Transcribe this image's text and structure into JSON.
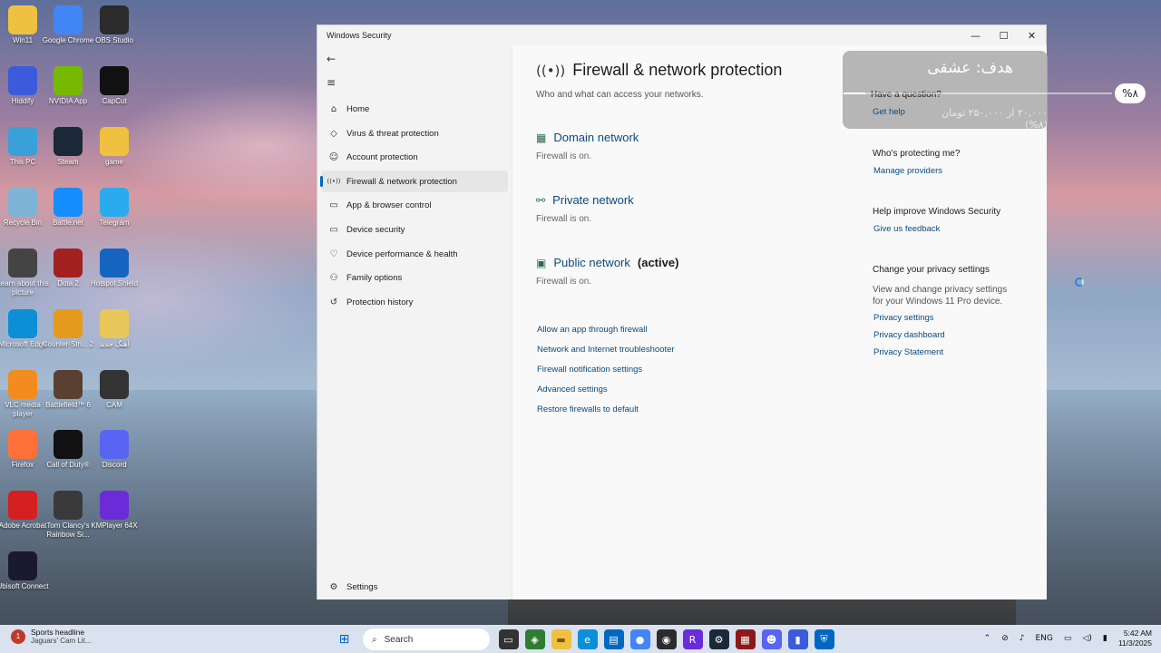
{
  "desktop": {
    "icons": [
      {
        "label": "Win11",
        "icon": "folder-icon",
        "color": "#f0c040"
      },
      {
        "label": "Google Chrome",
        "icon": "chrome-icon",
        "color": "#4285f4"
      },
      {
        "label": "OBS Studio",
        "icon": "obs-icon",
        "color": "#2b2b2b"
      },
      {
        "label": "Hiddify",
        "icon": "hiddify-icon",
        "color": "#3b5bdb"
      },
      {
        "label": "NVIDIA App",
        "icon": "nvidia-icon",
        "color": "#76b900"
      },
      {
        "label": "CapCut",
        "icon": "capcut-icon",
        "color": "#111111"
      },
      {
        "label": "This PC",
        "icon": "computer-icon",
        "color": "#3aa0d8"
      },
      {
        "label": "Steam",
        "icon": "steam-icon",
        "color": "#1b2838"
      },
      {
        "label": "game",
        "icon": "folder-icon",
        "color": "#f0c040"
      },
      {
        "label": "Recycle Bin",
        "icon": "recycle-bin-icon",
        "color": "#7fb3d5"
      },
      {
        "label": "Battle.net",
        "icon": "battlenet-icon",
        "color": "#148eff"
      },
      {
        "label": "Telegram",
        "icon": "telegram-icon",
        "color": "#2aabee"
      },
      {
        "label": "Learn about this picture",
        "icon": "camera-icon",
        "color": "#444444"
      },
      {
        "label": "Dota 2",
        "icon": "dota-icon",
        "color": "#a32020"
      },
      {
        "label": "Hotspot Shield",
        "icon": "hotspot-shield-icon",
        "color": "#1565c0"
      },
      {
        "label": "Microsoft Edge",
        "icon": "edge-icon",
        "color": "#0c8fd6"
      },
      {
        "label": "Counter-Stri... 2",
        "icon": "cs2-icon",
        "color": "#e69a1c"
      },
      {
        "label": "آهنگ جدید",
        "icon": "folder-icon",
        "color": "#e8c85a"
      },
      {
        "label": "VLC media player",
        "icon": "vlc-icon",
        "color": "#f28c1e"
      },
      {
        "label": "Battlefield™ 6",
        "icon": "battlefield-icon",
        "color": "#5a4030"
      },
      {
        "label": "CAM",
        "icon": "cam-icon",
        "color": "#333333"
      },
      {
        "label": "Firefox",
        "icon": "firefox-icon",
        "color": "#ff7139"
      },
      {
        "label": "Call of Duty®",
        "icon": "cod-icon",
        "color": "#111111"
      },
      {
        "label": "Discord",
        "icon": "discord-icon",
        "color": "#5865f2"
      },
      {
        "label": "Adobe Acrobat",
        "icon": "acrobat-icon",
        "color": "#d42020"
      },
      {
        "label": "Tom Clancy's Rainbow Si...",
        "icon": "rainbow-six-icon",
        "color": "#3a3a3a"
      },
      {
        "label": "KMPlayer 64X",
        "icon": "kmplayer-icon",
        "color": "#6a2bd8"
      },
      {
        "label": "Ubisoft Connect",
        "icon": "ubisoft-icon",
        "color": "#1a1a2e"
      }
    ]
  },
  "window": {
    "title": "Windows Security",
    "minimize": "—",
    "maximize": "☐",
    "close": "✕"
  },
  "nav": {
    "back": "←",
    "menu": "≡",
    "items": [
      {
        "label": "Home",
        "icon": "⌂"
      },
      {
        "label": "Virus & threat protection",
        "icon": "◇"
      },
      {
        "label": "Account protection",
        "icon": "☺"
      },
      {
        "label": "Firewall & network protection",
        "icon": "((•))"
      },
      {
        "label": "App & browser control",
        "icon": "▭"
      },
      {
        "label": "Device security",
        "icon": "▭"
      },
      {
        "label": "Device performance & health",
        "icon": "♡"
      },
      {
        "label": "Family options",
        "icon": "⚇"
      },
      {
        "label": "Protection history",
        "icon": "↺"
      }
    ],
    "settings": "Settings",
    "settings_icon": "⚙"
  },
  "main": {
    "title": "Firewall & network protection",
    "subtitle": "Who and what can access your networks.",
    "networks": [
      {
        "name": "Domain network",
        "status": "Firewall is on.",
        "active": ""
      },
      {
        "name": "Private network",
        "status": "Firewall is on.",
        "active": ""
      },
      {
        "name": "Public network",
        "status": "Firewall is on.",
        "active": "(active)"
      }
    ],
    "links": [
      "Allow an app through firewall",
      "Network and Internet troubleshooter",
      "Firewall notification settings",
      "Advanced settings",
      "Restore firewalls to default"
    ]
  },
  "side": {
    "question": "Have a question?",
    "get_help": "Get help",
    "protecting": "Who's protecting me?",
    "manage_providers": "Manage providers",
    "improve": "Help improve Windows Security",
    "feedback": "Give us feedback",
    "privacy_heading": "Change your privacy settings",
    "privacy_text": "View and change privacy settings for your Windows 11 Pro device.",
    "privacy_settings": "Privacy settings",
    "privacy_dashboard": "Privacy dashboard",
    "privacy_statement": "Privacy Statement"
  },
  "overlay": {
    "goal": "هدف: عشقی",
    "amount": "۲۰,۰۰۰ از ۲۵۰,۰۰۰ تومان (۸%)",
    "percent_badge": "%۸",
    "progress": 0.08
  },
  "taskbar": {
    "news_title": "Sports headline",
    "news_sub": "Jaguars' Cam Lit...",
    "news_badge": "1",
    "search_placeholder": "Search",
    "lang": "ENG",
    "time": "5:42 AM",
    "date": "11/3/2025"
  }
}
